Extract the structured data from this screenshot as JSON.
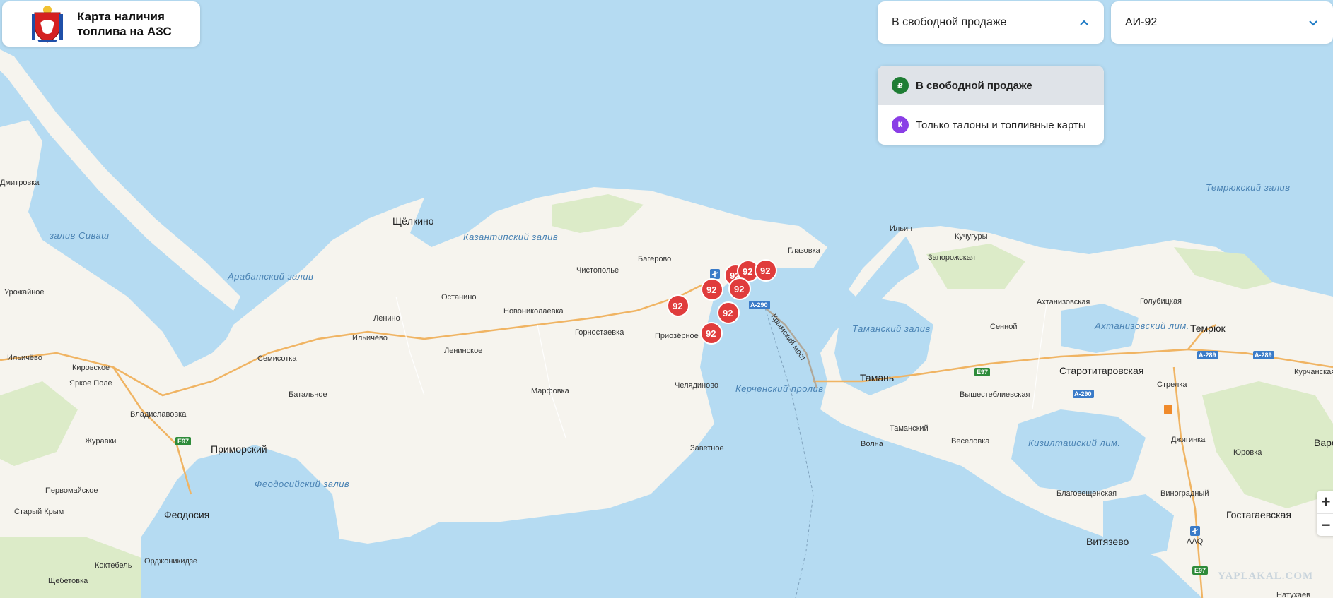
{
  "app": {
    "title": "Карта наличия топлива на АЗС"
  },
  "filters": {
    "mode": {
      "selected": "В свободной продаже",
      "options": [
        {
          "label": "В свободной продаже",
          "badge": "₽",
          "color": "#1e7d34",
          "active": true
        },
        {
          "label": "Только талоны и топливные карты",
          "badge": "К",
          "color": "#8a3ee6",
          "active": false
        }
      ]
    },
    "fuel": {
      "selected": "АИ-92"
    }
  },
  "map": {
    "labels": {
      "dmitrovka": "Дмитровка",
      "sivash": "залив Сиваш",
      "arabat": "Арабатский залив",
      "uroz": "Урожайное",
      "ilichevo": "Ильичёво",
      "ilichevo2": "Ильичёво",
      "kirovskoe": "Кировское",
      "yarkoe": "Яркое Поле",
      "vladislavovka": "Владиславовка",
      "zhuravki": "Журавки",
      "primorsky": "Приморский",
      "pervomayskoe": "Первомайское",
      "stary_krym": "Старый Крым",
      "feodosia": "Феодосия",
      "feod_gulf": "Феодосийский залив",
      "koktebel": "Коктебель",
      "ordzh": "Орджоникидзе",
      "shchebetovka": "Щебетовка",
      "semisotka": "Семисотка",
      "batalnoe": "Батальное",
      "lenino": "Ленино",
      "shchelkino": "Щёлкино",
      "kazantip": "Казантипский залив",
      "ostanino": "Останино",
      "novonikolaevka": "Новониколаевка",
      "leninskoe": "Ленинское",
      "chistopole": "Чистополье",
      "bagerovo": "Багерово",
      "gornostaevka": "Горностаевка",
      "marfovka": "Марфовка",
      "priozernoe": "Приозёрное",
      "chelyadinovo": "Челядиново",
      "zavetnoe": "Заветное",
      "glazovka": "Глазовка",
      "kerch_strait": "Керченский пролив",
      "krymsky_most": "Крымский мост",
      "ilyich": "Ильич",
      "kuchuguri": "Кучугуры",
      "zaporozhskaya": "Запорожская",
      "taman_gulf": "Таманский залив",
      "taman": "Тамань",
      "akhtanizovskaya": "Ахтанизовская",
      "akhtaniz_lim": "Ахтанизовский лим.",
      "golubitskaya": "Голубицкая",
      "temryuk": "Темрюк",
      "temryuk_gulf": "Темрюкский залив",
      "sennoy": "Сенной",
      "starotitarovskaya": "Старотитаровская",
      "vyshestebl": "Вышестеблиевская",
      "strelka": "Стрелка",
      "kurchanskaya": "Курчанская",
      "tamansky": "Таманский",
      "volna": "Волна",
      "veselovka": "Веселовка",
      "kiziltash": "Кизилташский лим.",
      "dzhiginka": "Джигинка",
      "yurovka": "Юровка",
      "varenikovskaya": "Варе",
      "vinogradny": "Виноградный",
      "blagoveshchenskaya": "Благовещенская",
      "gostagaevskaya": "Гостагаевская",
      "vityazevo": "Витязево",
      "aaq": "AAQ",
      "natukhaevo": "Натухаев"
    },
    "road_shields": {
      "e97_a": "E97",
      "e97_b": "E97",
      "e97_c": "E97",
      "a290_a": "A-290",
      "a290_b": "A-290",
      "a289_a": "A-289",
      "a289_b": "A-289"
    },
    "markers": [
      {
        "label": "92"
      },
      {
        "label": "92"
      },
      {
        "label": "92"
      },
      {
        "label": "92"
      },
      {
        "label": "92"
      },
      {
        "label": "92"
      },
      {
        "label": "92"
      },
      {
        "label": "92"
      }
    ],
    "zoom_in": "+",
    "zoom_out": "−"
  },
  "watermark": "YAPLAKAL.COM",
  "colors": {
    "water": "#b5dbf2",
    "land": "#f6f4ee",
    "green": "#dcebc8",
    "marker": "#e03c3c",
    "road": "#f0b463"
  }
}
